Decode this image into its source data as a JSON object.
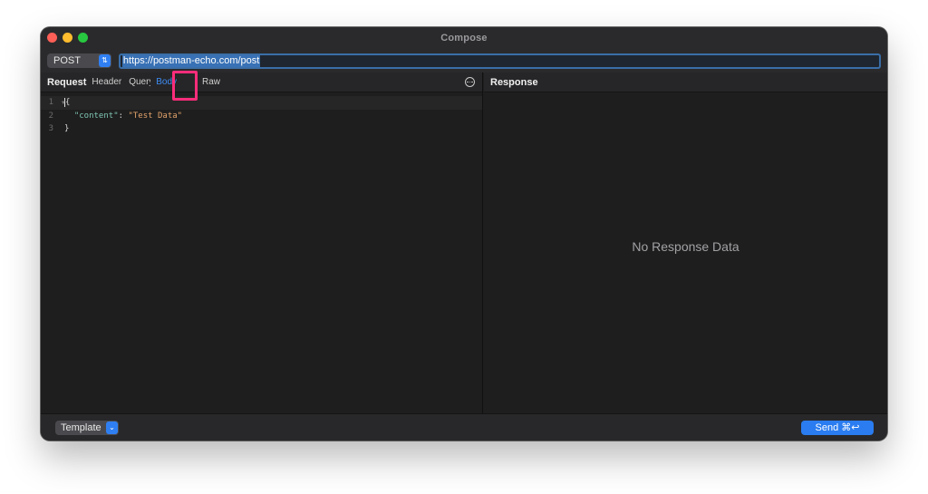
{
  "window": {
    "title": "Compose"
  },
  "request_line": {
    "method": "POST",
    "url": "https://postman-echo.com/post"
  },
  "request_pane": {
    "heading": "Request",
    "tabs": [
      {
        "label": "Header",
        "active": false
      },
      {
        "label": "Query",
        "active": false
      },
      {
        "label": "Body",
        "active": true
      },
      {
        "label": "Raw",
        "active": false
      }
    ],
    "editor": {
      "line_numbers": [
        "1",
        "2",
        "3"
      ],
      "lines": [
        "{",
        "\"content\"",
        ": ",
        "\"Test Data\"",
        "}"
      ]
    }
  },
  "response_pane": {
    "heading": "Response",
    "empty_message": "No Response Data"
  },
  "bottom": {
    "template_label": "Template",
    "send_label": "Send ⌘↩"
  },
  "colors": {
    "accent": "#2a7cf0",
    "highlight": "#ff2d7a",
    "json_key": "#7fc6b4",
    "json_string": "#e3a36b"
  }
}
